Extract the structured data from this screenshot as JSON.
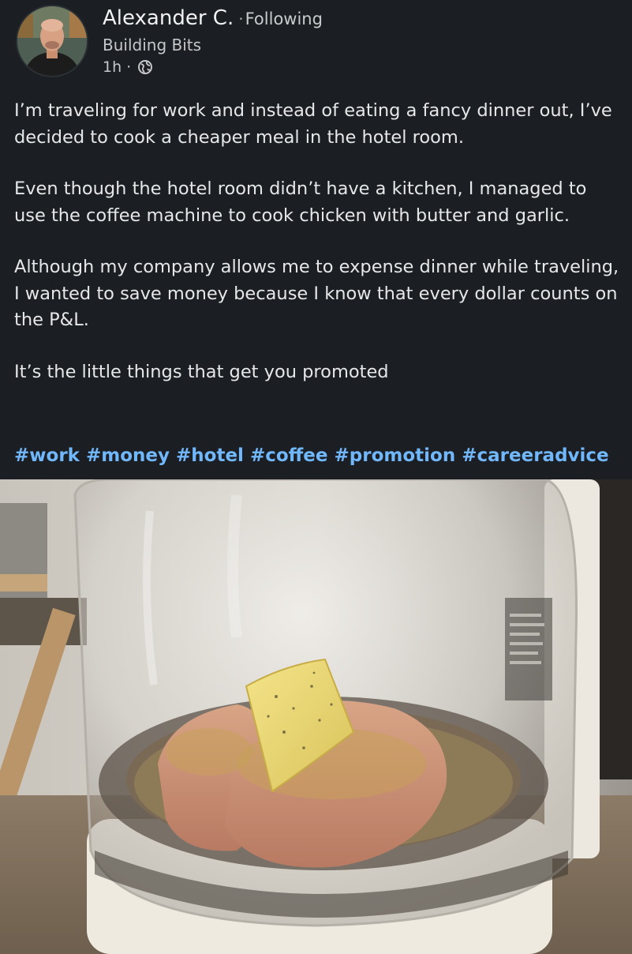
{
  "post": {
    "author": {
      "name": "Alexander C.",
      "separator": "·",
      "follow_status": "Following",
      "headline": "Building Bits",
      "timestamp": "1h",
      "time_separator": "·",
      "visibility_icon": "globe-icon"
    },
    "paragraphs": [
      "I’m traveling for work and instead of eating a fancy dinner out, I’ve decided to cook a cheaper meal in the hotel room.",
      "Even though the hotel room didn’t have a kitchen, I managed to use the coffee machine to cook chicken with butter and garlic.",
      "Although my company allows me to expense dinner while traveling, I wanted to save money because I know that every dollar counts on the P&L.",
      "It’s the little things that get you promoted"
    ],
    "hashtags": [
      "#work",
      "#money",
      "#hotel",
      "#coffee",
      "#promotion",
      "#careeradvice"
    ]
  },
  "colors": {
    "background": "#1b1f23",
    "text": "#e6e7e8",
    "secondary_text": "#c5c7c9",
    "hashtag": "#71b7fb"
  }
}
